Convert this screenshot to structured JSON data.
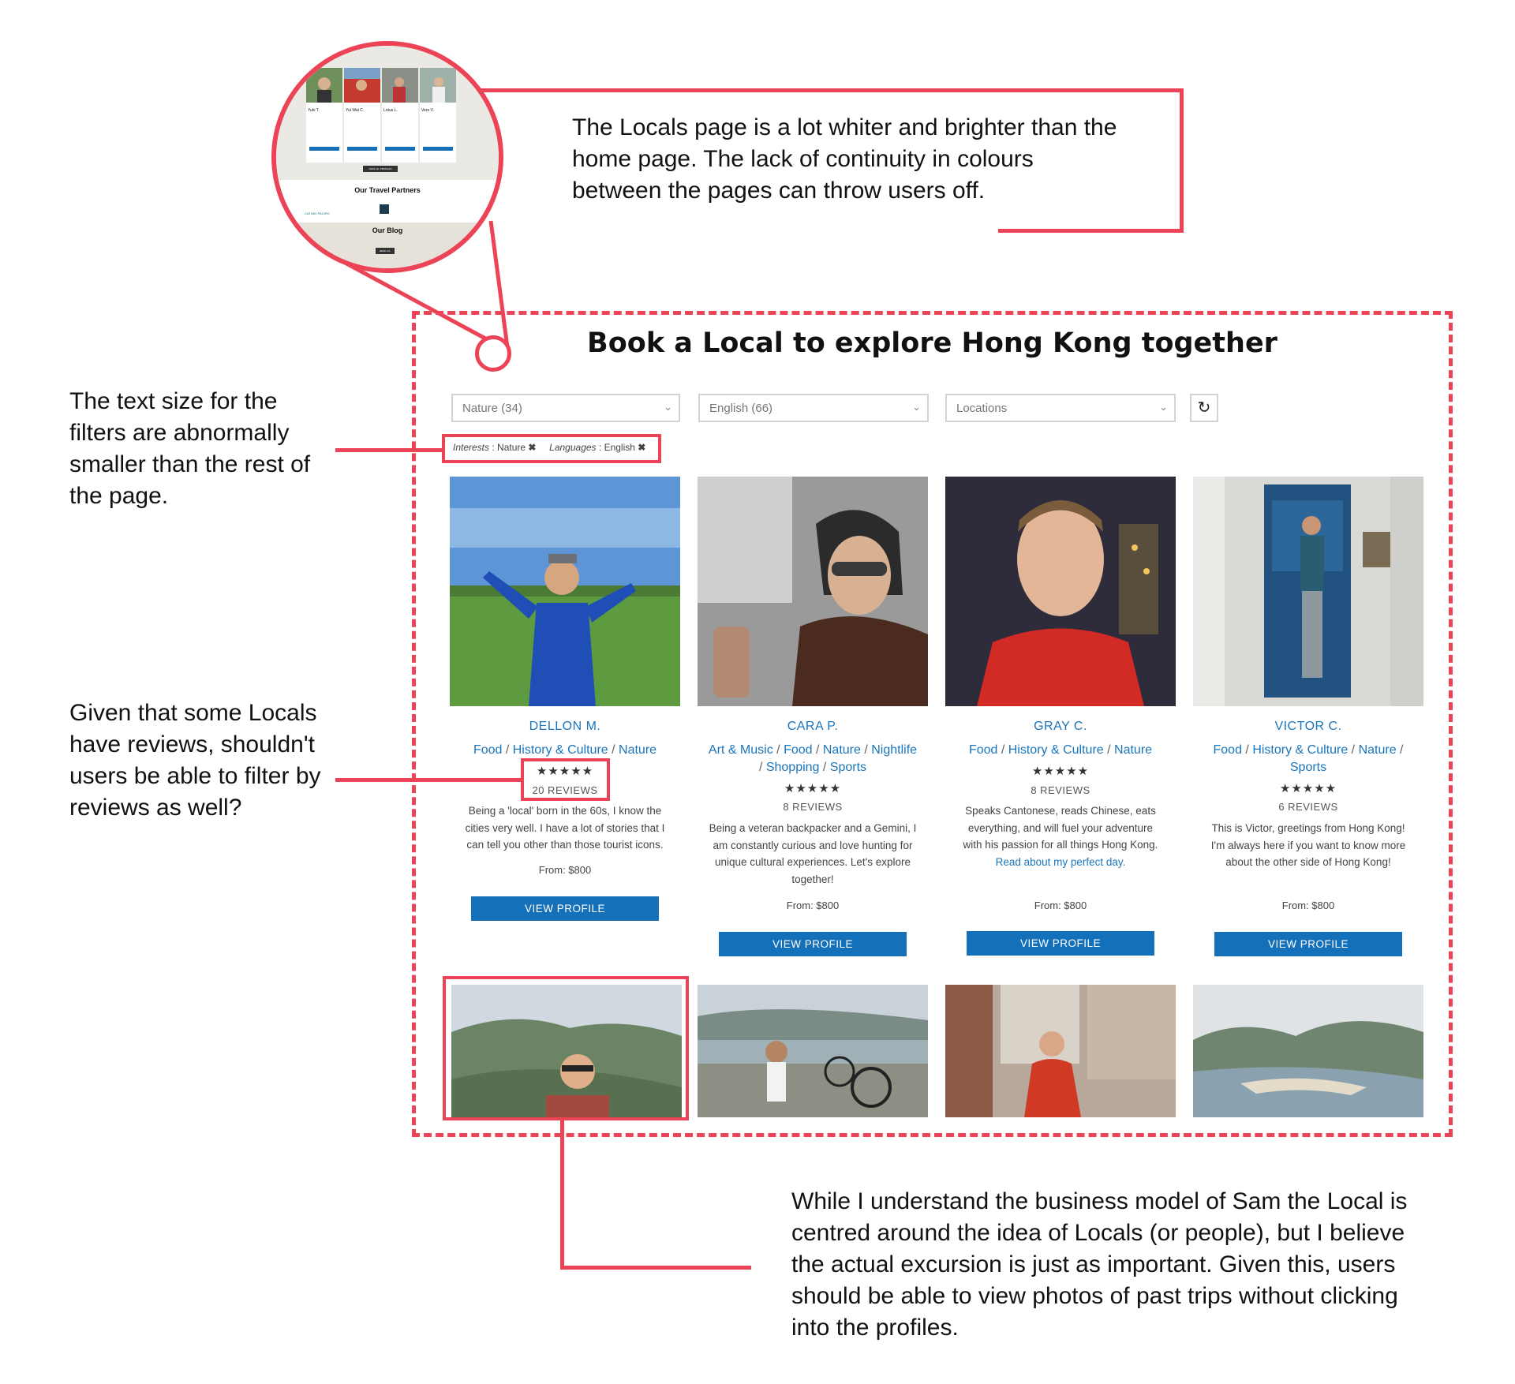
{
  "page": {
    "title": "Book a Local to explore Hong Kong together"
  },
  "filters": {
    "interest": "Nature (34)",
    "language": "English (66)",
    "location": "Locations",
    "chip_interests_label": "Interests",
    "chip_interests_value": "Nature",
    "chip_languages_label": "Languages",
    "chip_languages_value": "English"
  },
  "locals": [
    {
      "name": "DELLON M.",
      "tags": [
        "Food",
        "History & Culture",
        "Nature"
      ],
      "stars": "★★★★★",
      "reviews": "20 REVIEWS",
      "desc": "Being a 'local' born in the 60s, I know the cities very well. I have a lot of stories that I can tell you other than those tourist icons.",
      "price": "From: $800",
      "button": "VIEW PROFILE"
    },
    {
      "name": "CARA P.",
      "tags": [
        "Art & Music",
        "Food",
        "Nature",
        "Nightlife",
        "Shopping",
        "Sports"
      ],
      "stars": "★★★★★",
      "reviews": "8 REVIEWS",
      "desc": "Being a veteran backpacker and a Gemini, I am constantly curious and love hunting for unique cultural experiences. Let's explore together!",
      "price": "From: $800",
      "button": "VIEW PROFILE"
    },
    {
      "name": "GRAY C.",
      "tags": [
        "Food",
        "History & Culture",
        "Nature"
      ],
      "stars": "★★★★★",
      "reviews": "8 REVIEWS",
      "desc": "Speaks Cantonese, reads Chinese, eats everything, and will fuel your adventure with his passion for all things Hong Kong.",
      "desc_link": "Read about my perfect day.",
      "price": "From: $800",
      "button": "VIEW PROFILE"
    },
    {
      "name": "VICTOR C.",
      "tags": [
        "Food",
        "History & Culture",
        "Nature",
        "Sports"
      ],
      "stars": "★★★★★",
      "reviews": "6 REVIEWS",
      "desc": "This is Victor, greetings from Hong Kong! I'm always here if you want to know more about the other side of Hong Kong!",
      "price": "From: $800",
      "button": "VIEW PROFILE"
    }
  ],
  "annotations": {
    "top": "The Locals page is a lot whiter and brighter than the home page. The lack of continuity in colours between the pages can throw users off.",
    "filters": "The text size for the filters are abnormally smaller than the rest of the page.",
    "reviews": "Given that some Locals have reviews, shouldn't users be able to filter by reviews as well?",
    "photos": "While I understand the business model of Sam the Local is centred around the idea of Locals (or people), but I believe the actual excursion is just as important. Given this, users should be able to view photos of past trips without clicking into the profiles."
  },
  "magnifier": {
    "names": [
      "Yuki T.",
      "Yui Wai C.",
      "Lotus L.",
      "Vero V."
    ],
    "button": "VIEW ALL PROFILES",
    "partners_title": "Our Travel Partners",
    "partner_1": "CATHAY PACIFIC",
    "blog_title": "Our Blog",
    "blog_button": "READ ALL"
  },
  "colors": {
    "annotation_red": "#ec4356",
    "link_blue": "#1a75bb",
    "button_blue": "#1470b9"
  }
}
